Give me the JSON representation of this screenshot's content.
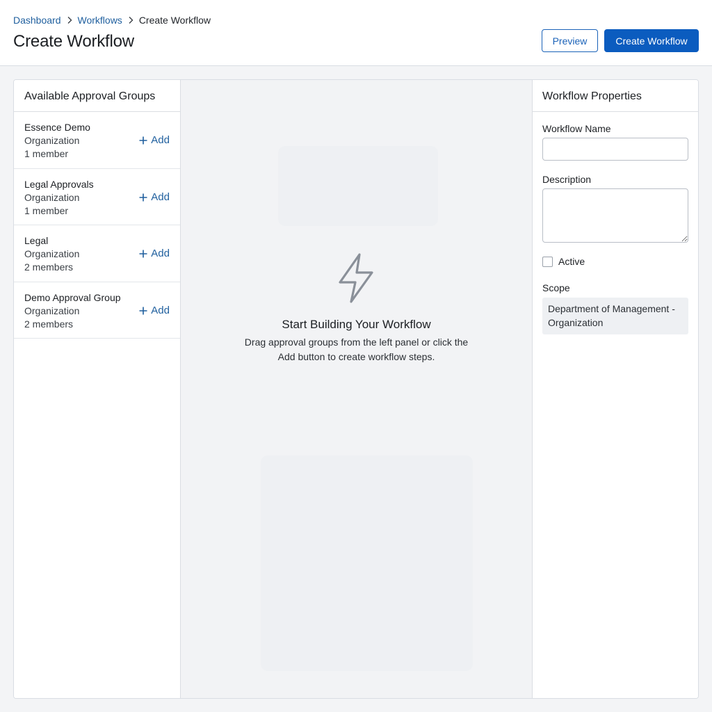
{
  "breadcrumb": {
    "items": [
      "Dashboard",
      "Workflows",
      "Create Workflow"
    ]
  },
  "header": {
    "title": "Create Workflow",
    "preview_label": "Preview",
    "create_label": "Create Workflow"
  },
  "left_panel": {
    "title": "Available Approval Groups",
    "add_label": "Add",
    "groups": [
      {
        "name": "Essence Demo",
        "type": "Organization",
        "members": "1 member"
      },
      {
        "name": "Legal Approvals",
        "type": "Organization",
        "members": "1 member"
      },
      {
        "name": "Legal",
        "type": "Organization",
        "members": "2 members"
      },
      {
        "name": "Demo Approval Group",
        "type": "Organization",
        "members": "2 members"
      }
    ]
  },
  "canvas": {
    "icon": "lightning-icon",
    "title": "Start Building Your Workflow",
    "description": "Drag approval groups from the left panel or click the Add button to create workflow steps."
  },
  "right_panel": {
    "title": "Workflow Properties",
    "workflow_name_label": "Workflow Name",
    "workflow_name_value": "",
    "description_label": "Description",
    "description_value": "",
    "active_label": "Active",
    "active_checked": false,
    "scope_label": "Scope",
    "scope_value": "Department of Management - Organization"
  },
  "colors": {
    "accent": "#0b5cbf",
    "link": "#1f5f9e",
    "background": "#f3f4f6"
  }
}
